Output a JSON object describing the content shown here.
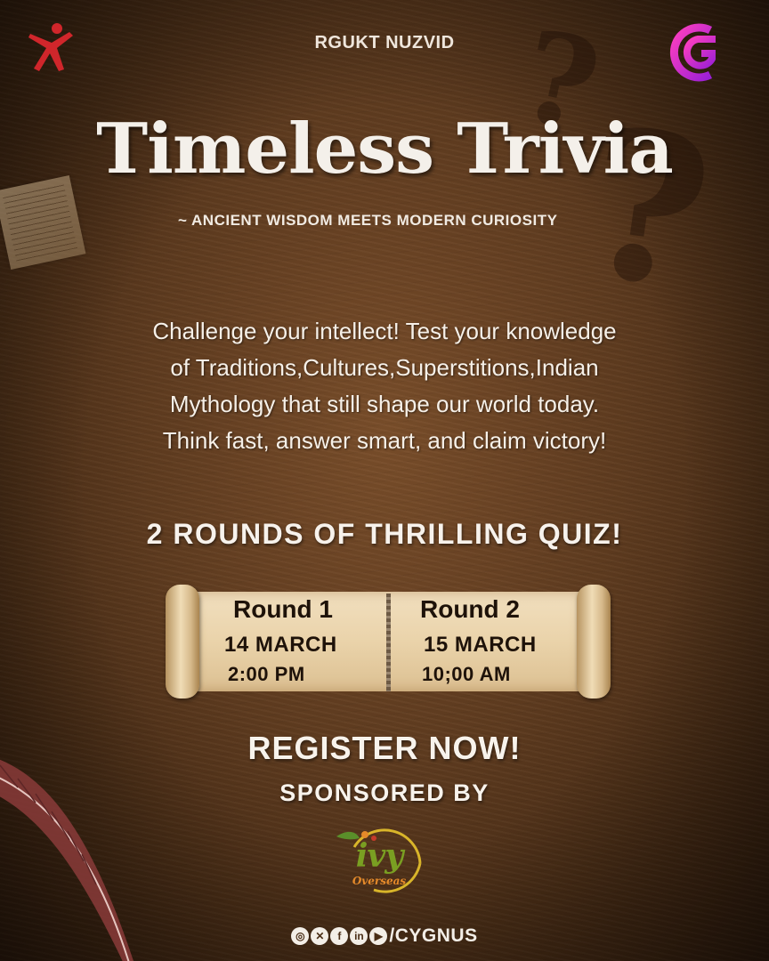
{
  "header": {
    "college": "RGUKT NUZVID"
  },
  "event": {
    "title": "Timeless Trivia",
    "subtitle": "~ ANCIENT WISDOM MEETS MODERN CURIOSITY",
    "description": [
      "Challenge your intellect! Test your knowledge",
      "of Traditions,Cultures,Superstitions,Indian",
      "Mythology that still shape our world today.",
      "Think fast, answer smart, and claim victory!"
    ],
    "rounds_heading": "2 ROUNDS OF THRILLING QUIZ!"
  },
  "rounds": [
    {
      "title": "Round 1",
      "date": "14 MARCH",
      "time": "2:00 PM"
    },
    {
      "title": "Round 2",
      "date": "15 MARCH",
      "time": "10;00 AM"
    }
  ],
  "cta": {
    "register": "REGISTER NOW!",
    "sponsored_by": "SPONSORED BY"
  },
  "sponsor": {
    "name": "ivy",
    "subname": "Overseas"
  },
  "social": {
    "icons": [
      "instagram-icon",
      "x-icon",
      "facebook-icon",
      "linkedin-icon",
      "youtube-icon"
    ],
    "handle": "/CYGNUS"
  },
  "colors": {
    "background": "#5e3b1f",
    "text": "#f6f0e8",
    "scroll": "#ead3aa",
    "club_logo": "#d81bd0",
    "left_logo": "#d0262b",
    "sponsor_green": "#7a9f22",
    "sponsor_orange": "#e58a2a"
  }
}
